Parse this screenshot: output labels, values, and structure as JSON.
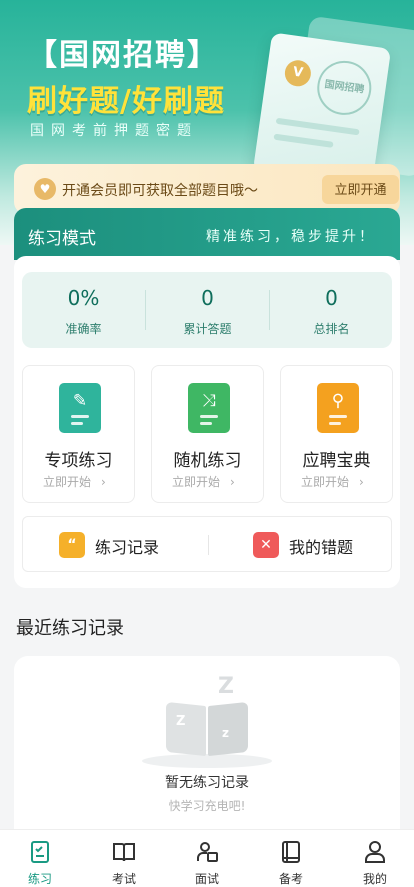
{
  "hero": {
    "title": "【国网招聘】",
    "slogan": "刷好题/好刷题",
    "tagline": "国网考前押题密题",
    "card_seal": "国网招聘",
    "card_badge": "V"
  },
  "vip": {
    "text": "开通会员即可获取全部题目哦～",
    "button": "立即开通"
  },
  "practice": {
    "title": "练习模式",
    "slogan": "精准练习，稳步提升！",
    "stats": [
      {
        "value": "0%",
        "label": "准确率"
      },
      {
        "value": "0",
        "label": "累计答题"
      },
      {
        "value": "0",
        "label": "总排名"
      }
    ],
    "modes": [
      {
        "name": "专项练习",
        "action": "立即开始",
        "icon": "pencil-icon",
        "color": "#2fb49c"
      },
      {
        "name": "随机练习",
        "action": "立即开始",
        "icon": "shuffle-icon",
        "color": "#3fb764"
      },
      {
        "name": "应聘宝典",
        "action": "立即开始",
        "icon": "magnifier-book-icon",
        "color": "#f4a11f"
      }
    ],
    "links": [
      {
        "label": "练习记录",
        "icon": "quote-icon",
        "color": "#f5b02a"
      },
      {
        "label": "我的错题",
        "icon": "error-x-icon",
        "color": "#ef5a5a"
      }
    ]
  },
  "recent": {
    "title": "最近练习记录",
    "empty_title": "暂无练习记录",
    "empty_sub": "快学习充电吧!"
  },
  "tabbar": {
    "active": "练习",
    "tabs": [
      {
        "label": "练习",
        "icon": "practice-doc-icon"
      },
      {
        "label": "考试",
        "icon": "open-book-icon"
      },
      {
        "label": "面试",
        "icon": "interview-person-icon"
      },
      {
        "label": "备考",
        "icon": "notebook-icon"
      },
      {
        "label": "我的",
        "icon": "user-icon"
      }
    ]
  },
  "colors": {
    "brand": "#1c9a83",
    "vip_bg": "#fdf2dc",
    "vip_text": "#6b4a17"
  }
}
